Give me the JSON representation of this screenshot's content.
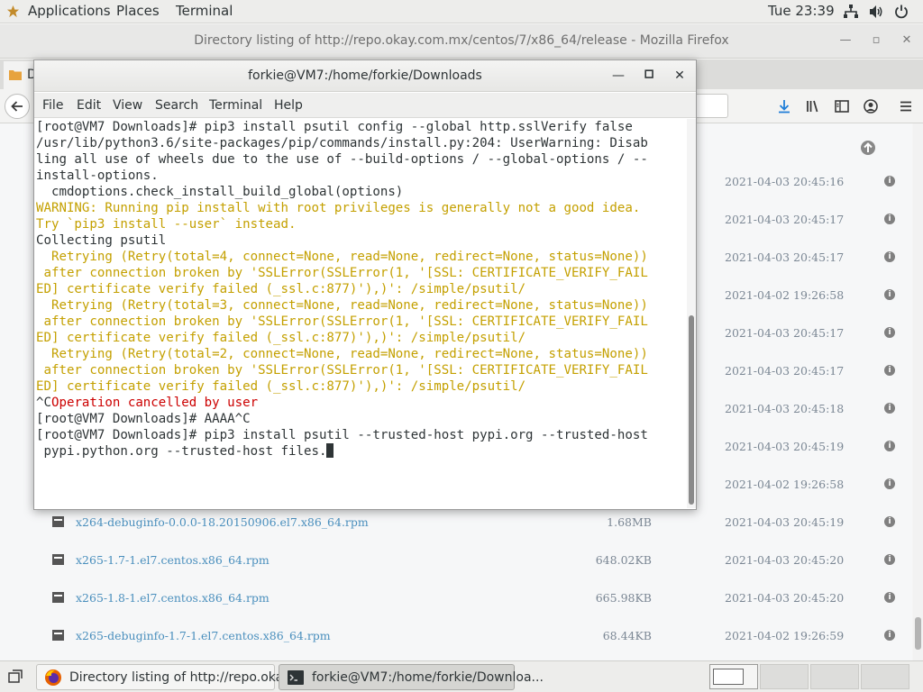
{
  "topbar": {
    "applications": "Applications",
    "places": "Places",
    "terminal": "Terminal",
    "clock": "Tue 23:39",
    "tray_icons": [
      "network-icon",
      "volume-icon",
      "power-icon"
    ]
  },
  "firefox": {
    "window_title": "Directory listing of http://repo.okay.com.mx/centos/7/x86_64/release - Mozilla Firefox",
    "tab_label": "D",
    "files": [
      {
        "name": "",
        "size": "",
        "date": "2021-04-03 20:45:16"
      },
      {
        "name": "",
        "size": "",
        "date": "2021-04-03 20:45:17"
      },
      {
        "name": "",
        "size": "",
        "date": "2021-04-03 20:45:17"
      },
      {
        "name": "",
        "size": "",
        "date": "2021-04-02 19:26:58"
      },
      {
        "name": "",
        "size": "",
        "date": "2021-04-03 20:45:17"
      },
      {
        "name": "",
        "size": "",
        "date": "2021-04-03 20:45:17"
      },
      {
        "name": "",
        "size": "",
        "date": "2021-04-03 20:45:18"
      },
      {
        "name": "",
        "size": "",
        "date": "2021-04-03 20:45:19"
      },
      {
        "name": "",
        "size": "",
        "date": "2021-04-02 19:26:58"
      },
      {
        "name": "x264-debuginfo-0.0.0-18.20150906.el7.x86_64.rpm",
        "size": "1.68MB",
        "date": "2021-04-03 20:45:19"
      },
      {
        "name": "x265-1.7-1.el7.centos.x86_64.rpm",
        "size": "648.02KB",
        "date": "2021-04-03 20:45:20"
      },
      {
        "name": "x265-1.8-1.el7.centos.x86_64.rpm",
        "size": "665.98KB",
        "date": "2021-04-03 20:45:20"
      },
      {
        "name": "x265-debuginfo-1.7-1.el7.centos.x86_64.rpm",
        "size": "68.44KB",
        "date": "2021-04-02 19:26:59"
      }
    ]
  },
  "terminal": {
    "window_title": "forkie@VM7:/home/forkie/Downloads",
    "menu": [
      "File",
      "Edit",
      "View",
      "Search",
      "Terminal",
      "Help"
    ],
    "lines": [
      "[root@VM7 Downloads]# pip3 install psutil config --global http.sslVerify false",
      "/usr/lib/python3.6/site-packages/pip/commands/install.py:204: UserWarning: Disab",
      "ling all use of wheels due to the use of --build-options / --global-options / --",
      "install-options.",
      "  cmdoptions.check_install_build_global(options)",
      "WARNING: Running pip install with root privileges is generally not a good idea.",
      "Try `pip3 install --user` instead.",
      "Collecting psutil",
      "  Retrying (Retry(total=4, connect=None, read=None, redirect=None, status=None))",
      " after connection broken by 'SSLError(SSLError(1, '[SSL: CERTIFICATE_VERIFY_FAIL",
      "ED] certificate verify failed (_ssl.c:877)'),)': /simple/psutil/",
      "  Retrying (Retry(total=3, connect=None, read=None, redirect=None, status=None))",
      " after connection broken by 'SSLError(SSLError(1, '[SSL: CERTIFICATE_VERIFY_FAIL",
      "ED] certificate verify failed (_ssl.c:877)'),)': /simple/psutil/",
      "  Retrying (Retry(total=2, connect=None, read=None, redirect=None, status=None))",
      " after connection broken by 'SSLError(SSLError(1, '[SSL: CERTIFICATE_VERIFY_FAIL",
      "ED] certificate verify failed (_ssl.c:877)'),)': /simple/psutil/",
      "^C",
      "[root@VM7 Downloads]# AAAA^C",
      "[root@VM7 Downloads]# pip3 install psutil --trusted-host pypi.org --trusted-host",
      " pypi.python.org --trusted-host files."
    ],
    "cancel_msg": "Operation cancelled by user",
    "colors": {
      "text": "#2e3436",
      "warning": "#c4a000",
      "error": "#cc0000"
    }
  },
  "taskbar": {
    "tasks": [
      {
        "label": "Directory listing of http://repo.okay....",
        "icon": "firefox-icon",
        "active": false
      },
      {
        "label": "forkie@VM7:/home/forkie/Downloa...",
        "icon": "terminal-icon",
        "active": true
      }
    ]
  }
}
